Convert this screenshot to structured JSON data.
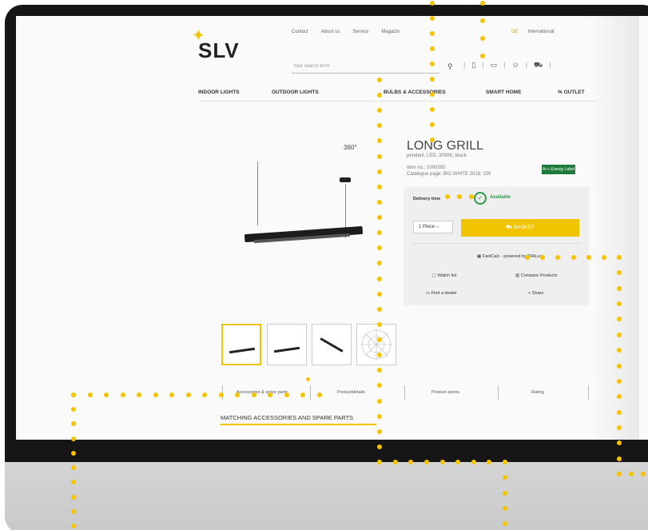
{
  "header": {
    "logo": "SLV",
    "top_links": [
      "Contact",
      "About us",
      "Service",
      "Magazin"
    ],
    "lang": {
      "active": "DE",
      "other": "International"
    },
    "search_placeholder": "Your search term"
  },
  "nav": [
    "INDOOR LIGHTS",
    "OUTDOOR LIGHTS",
    "BULBS & ACCESSORIES",
    "SMART HOME",
    "% OUTLET"
  ],
  "product": {
    "rotate_label": "360°",
    "title": "LONG GRILL",
    "subtitle": "pendant, LED, 3000K, black",
    "item_no": "Item no.: 1000392",
    "catalogue": "Catalogue page: BIG WHITE 2018: 159",
    "energy_label": "A++ Energy Label"
  },
  "buybox": {
    "delivery_label": "Delivery time",
    "availability": "Available",
    "quantity": "1 Piece",
    "basket": "BASKET",
    "fastcalc": "FastCalc - powered by DIALux",
    "watch_list": "Watch list",
    "compare": "Compare Products",
    "dealer": "Find a dealer",
    "share": "Share"
  },
  "tabs": [
    "Accessories & spare parts",
    "Productdetails",
    "Product series",
    "Rating"
  ],
  "section_title": "MATCHING ACCESSORIES AND SPARE PARTS",
  "colors": {
    "accent": "#f2c400",
    "available": "#2d9b4b"
  }
}
